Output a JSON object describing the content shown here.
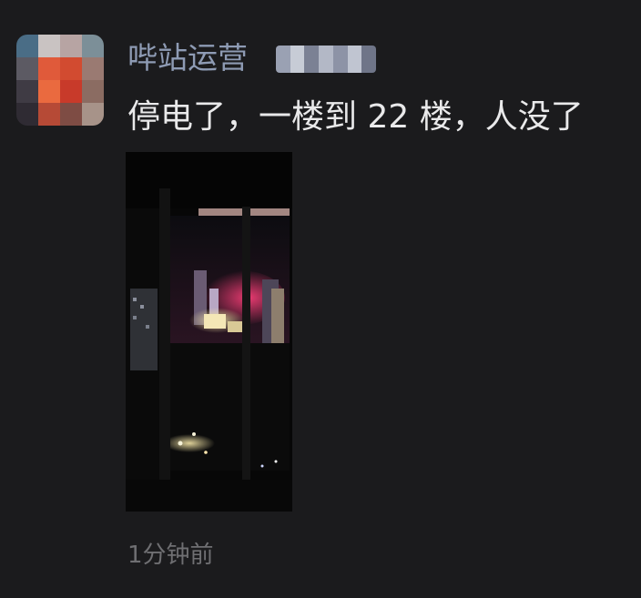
{
  "post": {
    "author": {
      "name": "哔站运营",
      "avatar_icon": "pixelated-avatar",
      "name_suffix_icon": "blurred-name-mosaic"
    },
    "content": "停电了，一楼到 22 楼，人没了",
    "image": {
      "icon": "night-window-photo"
    },
    "timestamp": "1分钟前"
  },
  "colors": {
    "background": "#1b1b1d",
    "author_name": "#8e9bb4",
    "content_text": "#e9e9ea",
    "timestamp": "#6f6f72"
  }
}
